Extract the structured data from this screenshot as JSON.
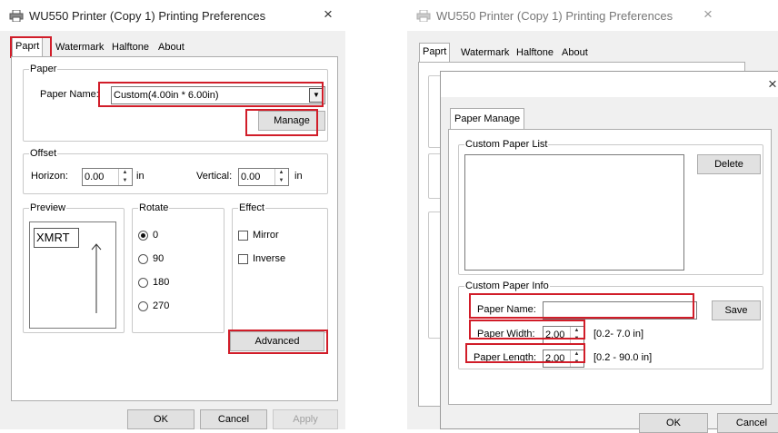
{
  "left_window": {
    "title": "WU550 Printer (Copy 1) Printing Preferences",
    "close_glyph": "×",
    "tabs": [
      "Paprt",
      "Watermark",
      "Halftone",
      "About"
    ],
    "paper_group": "Paper",
    "paper_name_label": "Paper Name:",
    "paper_name_value": "Custom(4.00in * 6.00in)",
    "manage_label": "Manage",
    "offset_group": "Offset",
    "horizon_label": "Horizon:",
    "horizon_value": "0.00",
    "horizon_unit": "in",
    "vertical_label": "Vertical:",
    "vertical_value": "0.00",
    "vertical_unit": "in",
    "preview_group": "Preview",
    "preview_text": "XMRT",
    "rotate_group": "Rotate",
    "rotate_options": [
      "0",
      "90",
      "180",
      "270"
    ],
    "rotate_selected": "0",
    "effect_group": "Effect",
    "effect_options": [
      "Mirror",
      "Inverse"
    ],
    "advanced_label": "Advanced",
    "ok_label": "OK",
    "cancel_label": "Cancel",
    "apply_label": "Apply"
  },
  "right_window": {
    "title": "WU550 Printer (Copy 1) Printing Preferences",
    "close_glyph": "×",
    "tabs": [
      "Paprt",
      "Watermark",
      "Halftone",
      "About"
    ]
  },
  "dialog": {
    "close_glyph": "×",
    "tab_label": "Paper Manage",
    "list_group": "Custom Paper List",
    "delete_label": "Delete",
    "info_group": "Custom Paper Info",
    "paper_name_label": "Paper Name:",
    "paper_name_value": "",
    "save_label": "Save",
    "width_label": "Paper Width:",
    "width_value": "2.00",
    "width_range": "[0.2- 7.0 in]",
    "length_label": "Paper Length:",
    "length_value": "2.00",
    "length_range": "[0.2 - 90.0 in]",
    "ok_label": "OK",
    "cancel_label": "Cancel"
  },
  "colors": {
    "highlight": "#d11d29",
    "window_bg": "#f0f0f0",
    "button_bg": "#e1e1e1"
  },
  "icons": [
    "printer-icon",
    "close-icon",
    "dropdown-arrow-icon",
    "spin-up-icon",
    "spin-down-icon",
    "up-arrow-icon"
  ]
}
